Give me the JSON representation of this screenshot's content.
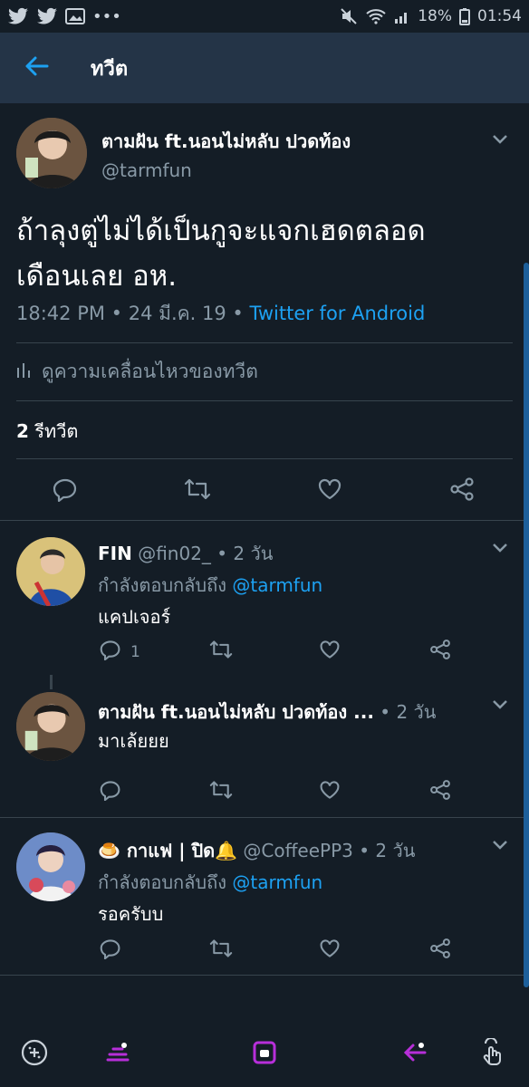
{
  "status": {
    "battery": "18%",
    "time": "01:54"
  },
  "header": {
    "title": "ทวีต"
  },
  "main_tweet": {
    "name": "ตามฝัน ft.นอนไม่หลับ ปวดท้อง",
    "handle": "@tarmfun",
    "text_line1": "ถ้าลุงตู่ไม่ได้เป็นกูจะแจกเฮดตลอด",
    "text_line2": "เดือนเลย อห.",
    "meta_time": "18:42 PM • 24 มี.ค. 19 • ",
    "meta_source": "Twitter for Android",
    "activity_label": "ดูความเคลื่อนไหวของทวีต",
    "retweet_count": "2",
    "retweet_label": " รีทวีต"
  },
  "replies": [
    {
      "name": "FIN",
      "handle_time": " @fin02_ • 2 วัน",
      "replying_prefix": "กำลังตอบกลับถึง ",
      "replying_mention": "@tarmfun",
      "text": "แคปเจอร์",
      "reply_count": "1"
    },
    {
      "name": "ตามฝัน ft.นอนไม่หลับ ปวดท้อง ...",
      "handle_time": " • 2 วัน",
      "text": "มาเล้ยยย"
    },
    {
      "name": "🍮 กาแฟ | ปิด🔔",
      "handle_time": " @CoffeePP3 • 2 วัน",
      "replying_prefix": "กำลังตอบกลับถึง ",
      "replying_mention": "@tarmfun",
      "text": "รอครับบ"
    }
  ],
  "colors": {
    "background": "#141d26",
    "header": "#243447",
    "accent": "#1da1f2",
    "muted": "#8899a6",
    "divider": "#38444d"
  },
  "icons": [
    "back-arrow-icon",
    "reply-icon",
    "retweet-icon",
    "like-icon",
    "share-icon",
    "chevron-down-icon",
    "activity-bars-icon"
  ]
}
